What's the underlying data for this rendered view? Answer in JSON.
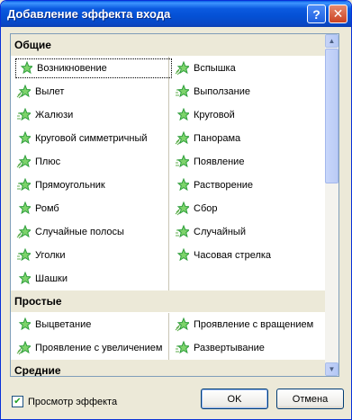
{
  "window": {
    "title": "Добавление эффекта входа",
    "help_glyph": "?",
    "close_glyph": "✕"
  },
  "groups": [
    {
      "header": "Общие",
      "left": [
        "Возникновение",
        "Вылет",
        "Жалюзи",
        "Круговой симметричный",
        "Плюс",
        "Прямоугольник",
        "Ромб",
        "Случайные полосы",
        "Уголки",
        "Шашки"
      ],
      "right": [
        "Вспышка",
        "Выползание",
        "Круговой",
        "Панорама",
        "Появление",
        "Растворение",
        "Сбор",
        "Случайный",
        "Часовая стрелка"
      ]
    },
    {
      "header": "Простые",
      "left": [
        "Выцветание",
        "Проявление с увеличением"
      ],
      "right": [
        "Проявление с вращением",
        "Развертывание"
      ]
    },
    {
      "header": "Средние",
      "left": [],
      "right": []
    }
  ],
  "selected_item": "Возникновение",
  "preview": {
    "label": "Просмотр эффекта",
    "checked": true
  },
  "buttons": {
    "ok": "OK",
    "cancel": "Отмена"
  },
  "colors": {
    "title_blue": "#0A47C4",
    "icon_green": "#2E9E3C",
    "group_bg": "#ECE9D8"
  }
}
